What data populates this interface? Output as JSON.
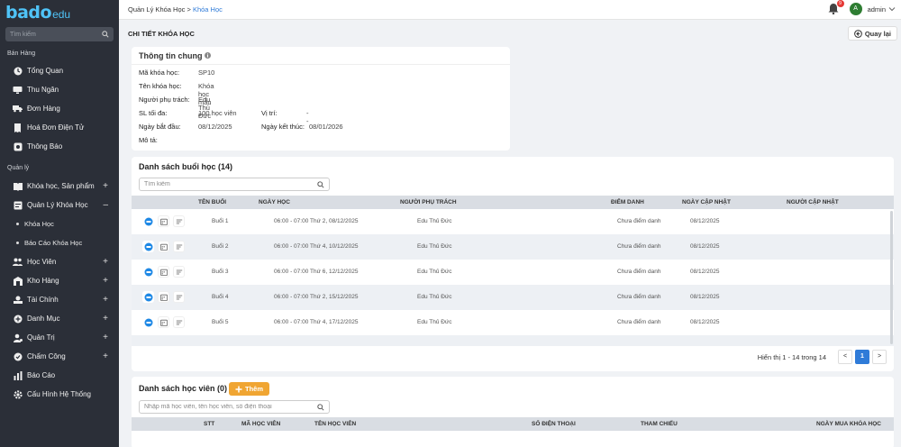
{
  "logo": {
    "brand": "bado",
    "suffix": "edu"
  },
  "sidebar": {
    "search_placeholder": "Tìm kiếm",
    "sections": [
      {
        "title": "Bán Hàng"
      },
      {
        "title": "Quản lý"
      }
    ],
    "sales_items": [
      {
        "label": "Tổng Quan",
        "icon": "dashboard-icon"
      },
      {
        "label": "Thu Ngân",
        "icon": "monitor-icon"
      },
      {
        "label": "Đơn Hàng",
        "icon": "truck-icon"
      },
      {
        "label": "Hoá Đơn Điện Tử",
        "icon": "receipt-icon"
      },
      {
        "label": "Thông Báo",
        "icon": "notification-icon"
      }
    ],
    "manage_items": [
      {
        "label": "Khóa học, Sản phẩm",
        "icon": "book-icon",
        "toggle": "+"
      },
      {
        "label": "Quản Lý Khóa Học",
        "icon": "course-icon",
        "toggle": "–"
      },
      {
        "label": "Khóa Học"
      },
      {
        "label": "Báo Cáo Khóa Học"
      },
      {
        "label": "Học Viên",
        "icon": "users-icon",
        "toggle": "+"
      },
      {
        "label": "Kho Hàng",
        "icon": "warehouse-icon",
        "toggle": "+"
      },
      {
        "label": "Tài Chính",
        "icon": "finance-icon",
        "toggle": "+"
      },
      {
        "label": "Danh Mục",
        "icon": "category-icon",
        "toggle": "+"
      },
      {
        "label": "Quản Trị",
        "icon": "admin-icon",
        "toggle": "+"
      },
      {
        "label": "Chấm Công",
        "icon": "timesheet-icon",
        "toggle": "+"
      },
      {
        "label": "Báo Cáo",
        "icon": "chart-icon"
      },
      {
        "label": "Cấu Hình Hệ Thống",
        "icon": "settings-icon"
      }
    ]
  },
  "header": {
    "breadcrumb_parent": "Quản Lý Khóa Học",
    "breadcrumb_sep": ">",
    "breadcrumb_current": "Khóa Học",
    "notif_count": "9",
    "avatar_letter": "A",
    "username": "admin"
  },
  "page": {
    "title": "CHI TIẾT KHÓA HỌC",
    "back_label": "Quay lại"
  },
  "info": {
    "title": "Thông tin chung",
    "fields": {
      "code_k": "Mã khóa học:",
      "code_v": "SP10",
      "name_k": "Tên khóa học:",
      "name_v": "Khóa học mẫu",
      "owner_k": "Người phụ trách:",
      "owner_v": "Edu Thủ Đức",
      "max_k": "SL tối đa:",
      "max_v": "100 học viên",
      "loc_k": "Vị trí:",
      "loc_v": "--",
      "start_k": "Ngày bắt đầu:",
      "start_v": "08/12/2025",
      "end_k": "Ngày kết thúc:",
      "end_v": "08/01/2026",
      "desc_k": "Mô tả:"
    }
  },
  "sessions": {
    "title": "Danh sách buổi học (14)",
    "search_placeholder": "Tìm kiếm",
    "columns": [
      "TÊN BUỔI",
      "NGÀY HỌC",
      "NGƯỜI PHỤ TRÁCH",
      "ĐIỂM DANH",
      "NGÀY CẬP NHẬT",
      "NGƯỜI CẬP NHẬT"
    ],
    "rows": [
      [
        "Buổi 1",
        "06:00 - 07:00 Thứ 2, 08/12/2025",
        "Edu Thủ Đức",
        "Chưa điểm danh",
        "08/12/2025"
      ],
      [
        "Buổi 2",
        "06:00 - 07:00 Thứ 4, 10/12/2025",
        "Edu Thủ Đức",
        "Chưa điểm danh",
        "08/12/2025"
      ],
      [
        "Buổi 3",
        "06:00 - 07:00 Thứ 6, 12/12/2025",
        "Edu Thủ Đức",
        "Chưa điểm danh",
        "08/12/2025"
      ],
      [
        "Buổi 4",
        "06:00 - 07:00 Thứ 2, 15/12/2025",
        "Edu Thủ Đức",
        "Chưa điểm danh",
        "08/12/2025"
      ],
      [
        "Buổi 5",
        "06:00 - 07:00 Thứ 4, 17/12/2025",
        "Edu Thủ Đức",
        "Chưa điểm danh",
        "08/12/2025"
      ]
    ],
    "pager_info": "Hiển thị 1 - 14 trong 14",
    "pager_prev": "<",
    "pager_page": "1",
    "pager_next": ">"
  },
  "students": {
    "title": "Danh sách học viên (0)",
    "add_label": "Thêm",
    "search_placeholder": "Nhập mã học viên, tên học viên, số điện thoại",
    "columns": [
      "STT",
      "MÃ HỌC VIÊN",
      "TÊN HỌC VIÊN",
      "SỐ ĐIỆN THOẠI",
      "THAM CHIẾU",
      "NGÀY MUA KHÓA HỌC"
    ]
  },
  "colors": {
    "sidebar": "#2b2f38",
    "accent": "#2f7bd8",
    "add_button": "#f0a532",
    "table_header": "#d9dde3"
  }
}
